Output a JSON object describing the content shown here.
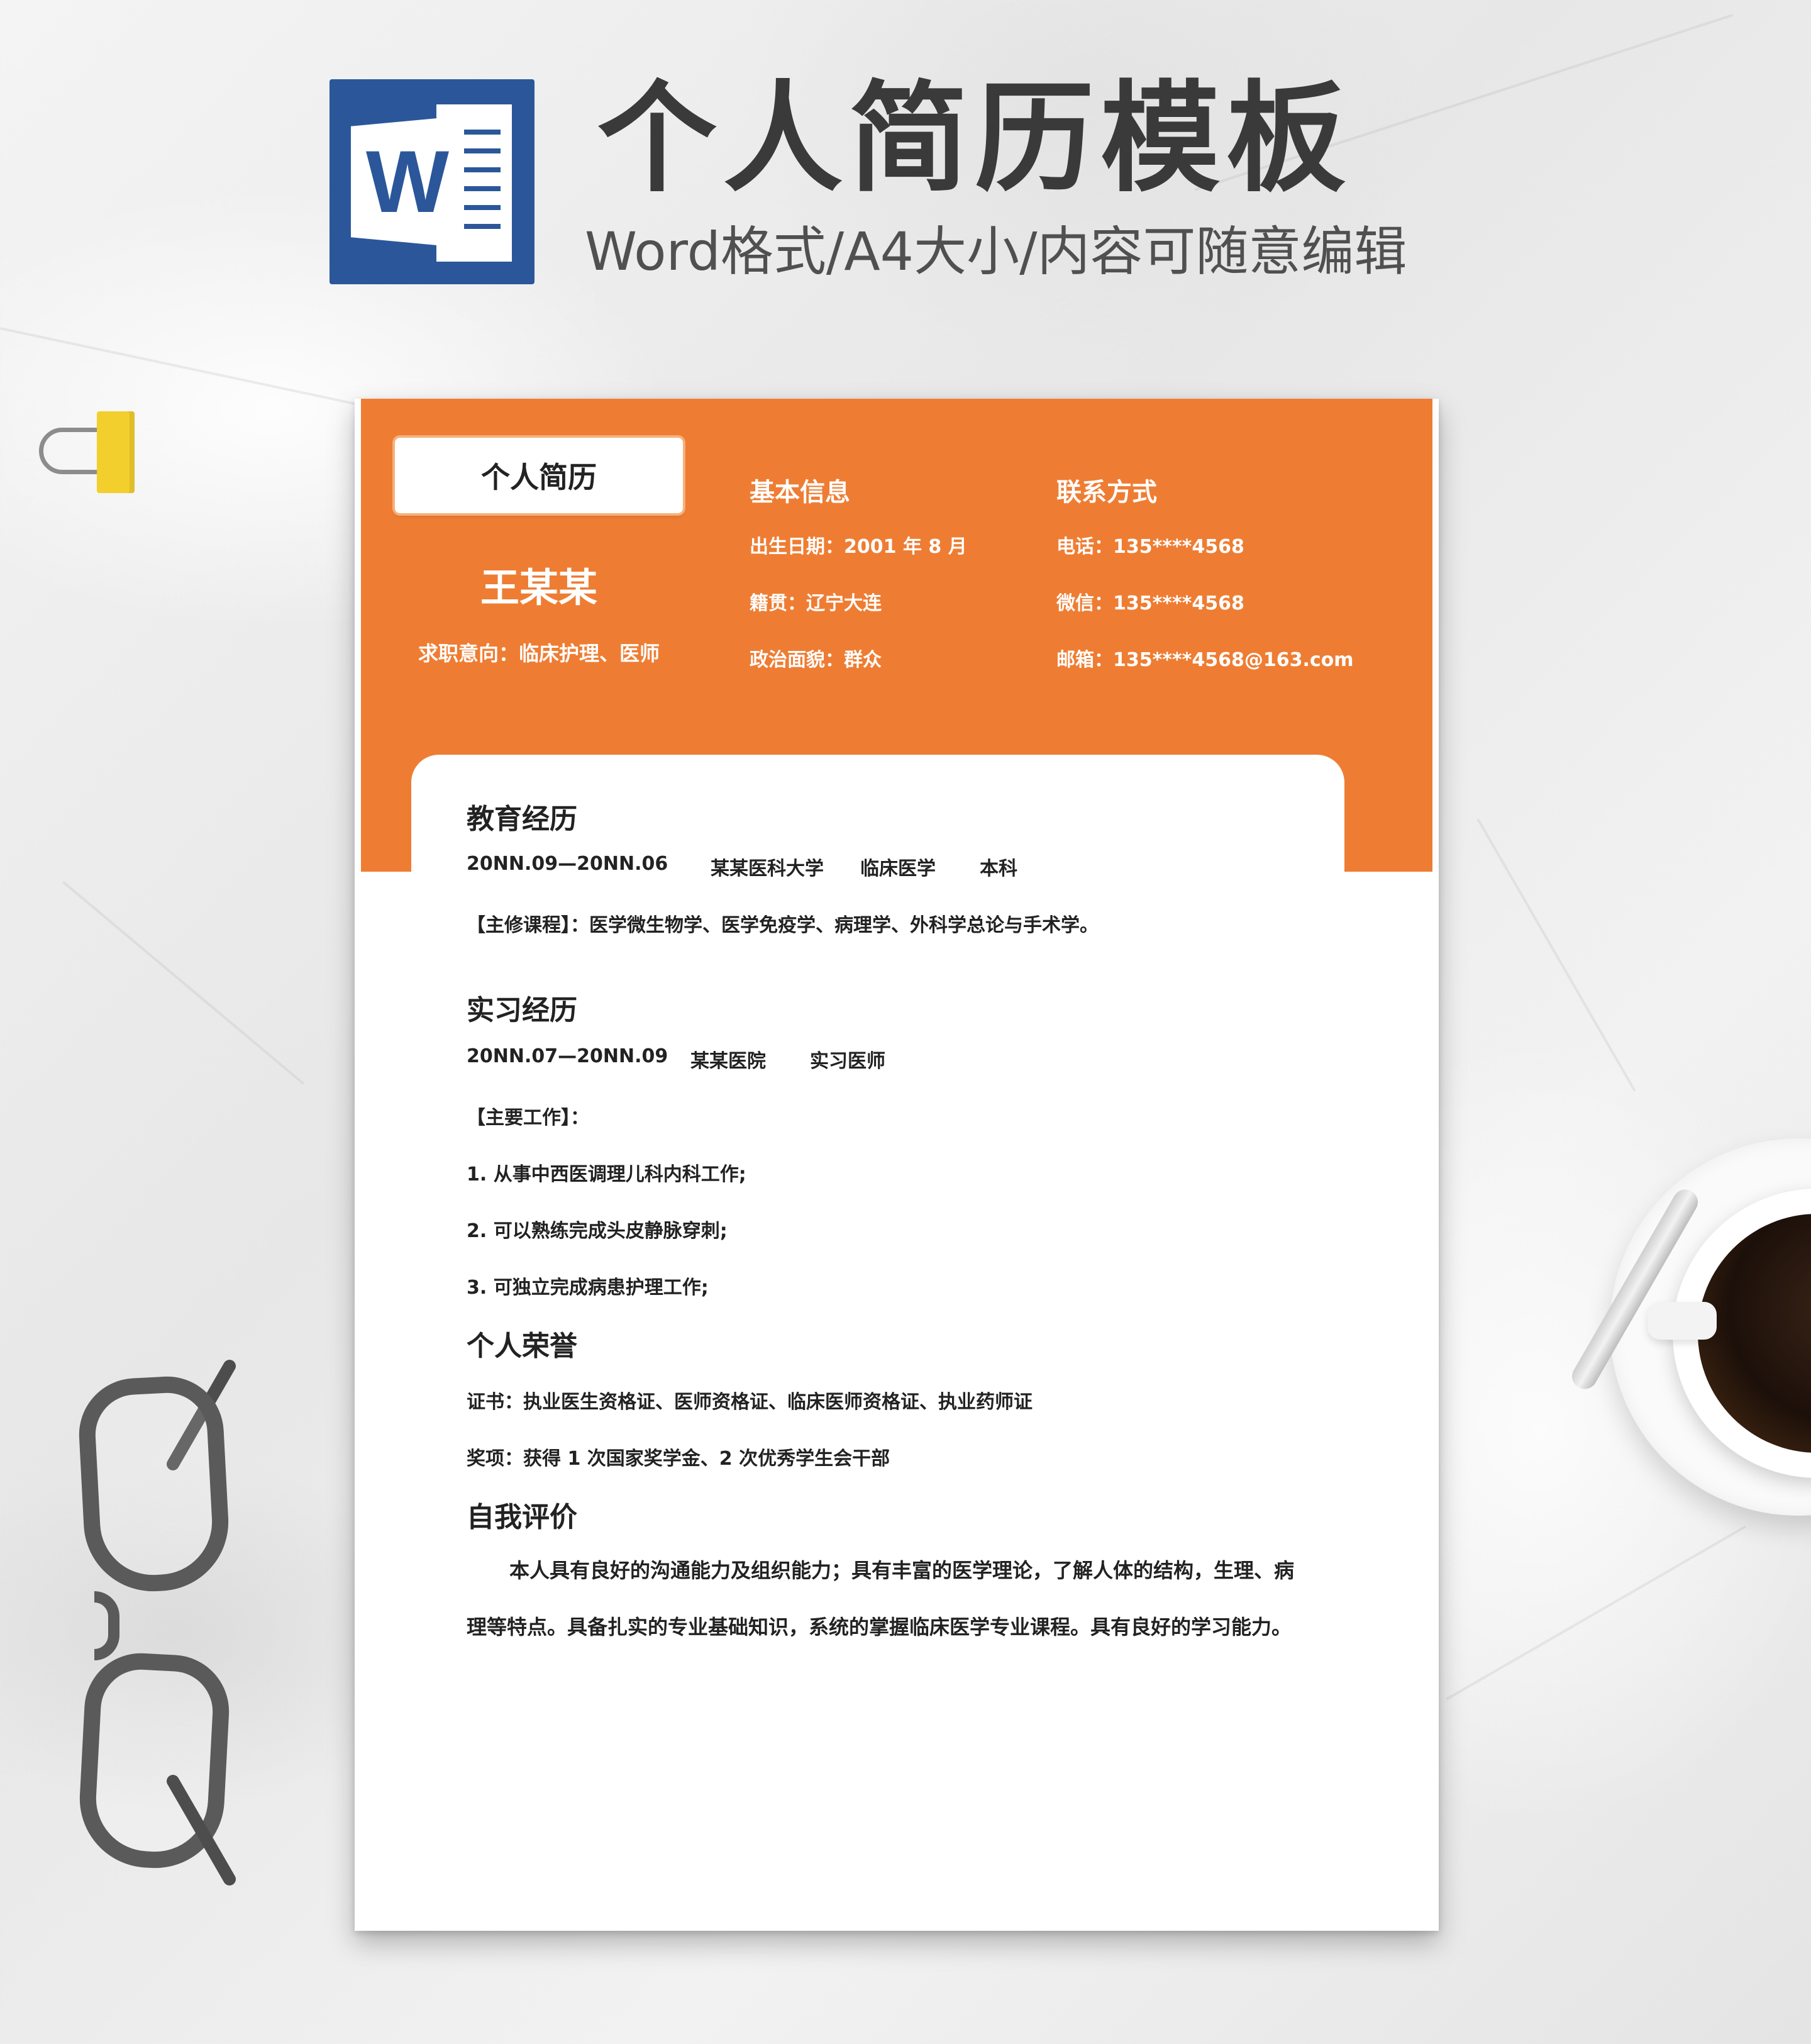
{
  "banner": {
    "title": "个人简历模板",
    "subtitle": "Word格式/A4大小/内容可随意编辑",
    "logo_letter": "W"
  },
  "resume": {
    "box_title": "个人简历",
    "name": "王某某",
    "intent": "求职意向：临床护理、医师",
    "basic": {
      "heading": "基本信息",
      "rows": [
        "出生日期：2001 年 8 月",
        "籍贯：辽宁大连",
        "政治面貌：群众"
      ]
    },
    "contact": {
      "heading": "联系方式",
      "rows": [
        "电话：135****4568",
        "微信：135****4568",
        "邮箱：135****4568@163.com"
      ]
    },
    "education": {
      "heading": "教育经历",
      "period": "20NN.09—20NN.06",
      "school": "某某医科大学",
      "major": "临床医学",
      "degree": "本科",
      "courses": "【主修课程】：医学微生物学、医学免疫学、病理学、外科学总论与手术学。"
    },
    "internship": {
      "heading": "实习经历",
      "period": "20NN.07—20NN.09",
      "place": "某某医院",
      "role": "实习医师",
      "work_label": "【主要工作】：",
      "items": [
        "1.  从事中西医调理儿科内科工作;",
        "2.  可以熟练完成头皮静脉穿刺;",
        "3.  可独立完成病患护理工作;"
      ]
    },
    "honors": {
      "heading": "个人荣誉",
      "cert": "证书：执业医生资格证、医师资格证、临床医师资格证、执业药师证",
      "award": "奖项：获得 1 次国家奖学金、2 次优秀学生会干部"
    },
    "self_eval": {
      "heading": "自我评价",
      "text": "本人具有良好的沟通能力及组织能力；具有丰富的医学理论，了解人体的结构，生理、病理等特点。具备扎实的专业基础知识，系统的掌握临床医学专业课程。具有良好的学习能力。"
    }
  },
  "colors": {
    "accent": "#ee7d33",
    "word_blue": "#2b579a"
  },
  "icons": [
    "word-icon",
    "binder-clip",
    "coffee-cup",
    "glasses"
  ]
}
